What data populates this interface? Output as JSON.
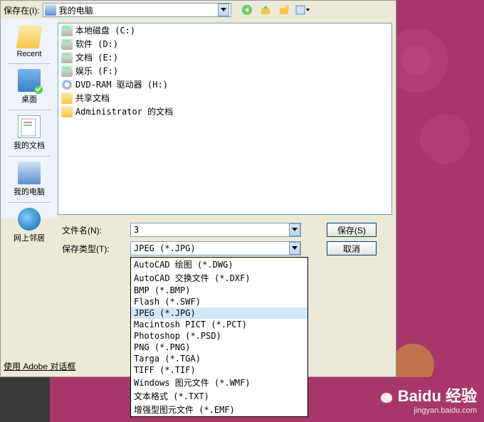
{
  "topbar": {
    "save_in_label": "保存在(I):",
    "location": "我的电脑"
  },
  "toolbar_icons": [
    "back-icon",
    "up-icon",
    "new-folder-icon",
    "view-menu-icon"
  ],
  "sidebar": {
    "items": [
      {
        "label": "Recent",
        "icon": "recent"
      },
      {
        "label": "桌面",
        "icon": "desktop"
      },
      {
        "label": "我的文档",
        "icon": "mydocs"
      },
      {
        "label": "我的电脑",
        "icon": "computer"
      },
      {
        "label": "网上邻居",
        "icon": "network"
      }
    ]
  },
  "files": [
    {
      "label": "本地磁盘 (C:)",
      "icon": "drive"
    },
    {
      "label": "软件 (D:)",
      "icon": "drive"
    },
    {
      "label": "文档 (E:)",
      "icon": "drive"
    },
    {
      "label": "娱乐 (F:)",
      "icon": "drive"
    },
    {
      "label": "DVD-RAM 驱动器 (H:)",
      "icon": "dvd"
    },
    {
      "label": "共享文档",
      "icon": "folder"
    },
    {
      "label": "Administrator 的文档",
      "icon": "folder"
    }
  ],
  "bottom": {
    "filename_label": "文件名(N):",
    "filename_value": "3",
    "filetype_label": "保存类型(T):",
    "filetype_value": "JPEG (*.JPG)",
    "save_button": "保存(S)",
    "cancel_button": "取消"
  },
  "type_options": [
    "AutoCAD 绘图 (*.DWG)",
    "AutoCAD 交换文件 (*.DXF)",
    "BMP (*.BMP)",
    "Flash (*.SWF)",
    "JPEG (*.JPG)",
    "Macintosh PICT (*.PCT)",
    "Photoshop (*.PSD)",
    "PNG (*.PNG)",
    "Targa (*.TGA)",
    "TIFF (*.TIF)",
    "Windows 图元文件 (*.WMF)",
    "文本格式 (*.TXT)",
    "增强型图元文件 (*.EMF)"
  ],
  "type_selected_index": 4,
  "adobe_link": "使用 Adobe 对话框",
  "watermark": {
    "brand": "Baidu 经验",
    "sub": "jingyan.baidu.com"
  }
}
